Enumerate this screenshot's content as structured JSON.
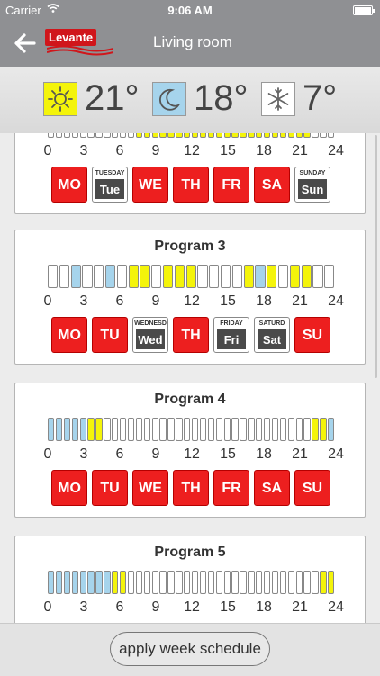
{
  "status_bar": {
    "carrier": "Carrier",
    "time": "9:06 AM"
  },
  "nav": {
    "brand": "Levante",
    "title": "Living room"
  },
  "temperatures": {
    "day": "21°",
    "night": "18°",
    "frost": "7°"
  },
  "hour_ticks": [
    "0",
    "3",
    "6",
    "9",
    "12",
    "15",
    "18",
    "21",
    "24"
  ],
  "apply_label": "apply week schedule",
  "colors": {
    "day": "#f4f40a",
    "night": "#a6d4ec",
    "off": "#ffffff",
    "active_day": "#ed1f1f",
    "inactive_day": "#4a4a4a"
  },
  "programs": [
    {
      "title": "",
      "slots": [
        "off",
        "off",
        "off",
        "off",
        "off",
        "off",
        "off",
        "off",
        "off",
        "off",
        "off",
        "day",
        "day",
        "day",
        "day",
        "day",
        "day",
        "day",
        "day",
        "day",
        "day",
        "day",
        "day",
        "day",
        "day",
        "day",
        "day",
        "day",
        "day",
        "day",
        "day",
        "day",
        "day",
        "off",
        "off",
        "off"
      ],
      "days": [
        {
          "short": "MO",
          "active": true
        },
        {
          "short": "Tue",
          "long": "TUESDAY",
          "active": false
        },
        {
          "short": "WE",
          "active": true
        },
        {
          "short": "TH",
          "active": true
        },
        {
          "short": "FR",
          "active": true
        },
        {
          "short": "SA",
          "active": true
        },
        {
          "short": "Sun",
          "long": "SUNDAY",
          "active": false
        }
      ]
    },
    {
      "title": "Program 3",
      "slots": [
        "off",
        "off",
        "night",
        "off",
        "off",
        "night",
        "off",
        "day",
        "day",
        "off",
        "day",
        "day",
        "day",
        "off",
        "off",
        "off",
        "off",
        "day",
        "night",
        "day",
        "off",
        "day",
        "day",
        "off",
        "off"
      ],
      "days": [
        {
          "short": "MO",
          "active": true
        },
        {
          "short": "TU",
          "active": true
        },
        {
          "short": "Wed",
          "long": "WEDNESD",
          "active": false
        },
        {
          "short": "TH",
          "active": true
        },
        {
          "short": "Fri",
          "long": "FRIDAY",
          "active": false
        },
        {
          "short": "Sat",
          "long": "SATURD",
          "active": false
        },
        {
          "short": "SU",
          "active": true
        }
      ]
    },
    {
      "title": "Program 4",
      "slots": [
        "night",
        "night",
        "night",
        "night",
        "night",
        "day",
        "day",
        "off",
        "off",
        "off",
        "off",
        "off",
        "off",
        "off",
        "off",
        "off",
        "off",
        "off",
        "off",
        "off",
        "off",
        "off",
        "off",
        "off",
        "off",
        "off",
        "off",
        "off",
        "off",
        "off",
        "off",
        "off",
        "off",
        "day",
        "day",
        "night"
      ],
      "days": [
        {
          "short": "MO",
          "active": true
        },
        {
          "short": "TU",
          "active": true
        },
        {
          "short": "WE",
          "active": true
        },
        {
          "short": "TH",
          "active": true
        },
        {
          "short": "FR",
          "active": true
        },
        {
          "short": "SA",
          "active": true
        },
        {
          "short": "SU",
          "active": true
        }
      ]
    },
    {
      "title": "Program 5",
      "slots": [
        "night",
        "night",
        "night",
        "night",
        "night",
        "night",
        "night",
        "night",
        "day",
        "day",
        "off",
        "off",
        "off",
        "off",
        "off",
        "off",
        "off",
        "off",
        "off",
        "off",
        "off",
        "off",
        "off",
        "off",
        "off",
        "off",
        "off",
        "off",
        "off",
        "off",
        "off",
        "off",
        "off",
        "off",
        "day",
        "day"
      ],
      "days": [
        {
          "short": "MO",
          "active": true
        },
        {
          "short": "TU",
          "active": true
        },
        {
          "short": "WE",
          "active": true
        },
        {
          "short": "TH",
          "active": true
        },
        {
          "short": "FR",
          "active": true
        },
        {
          "short": "SA",
          "active": true
        },
        {
          "short": "SU",
          "active": true
        }
      ]
    }
  ]
}
